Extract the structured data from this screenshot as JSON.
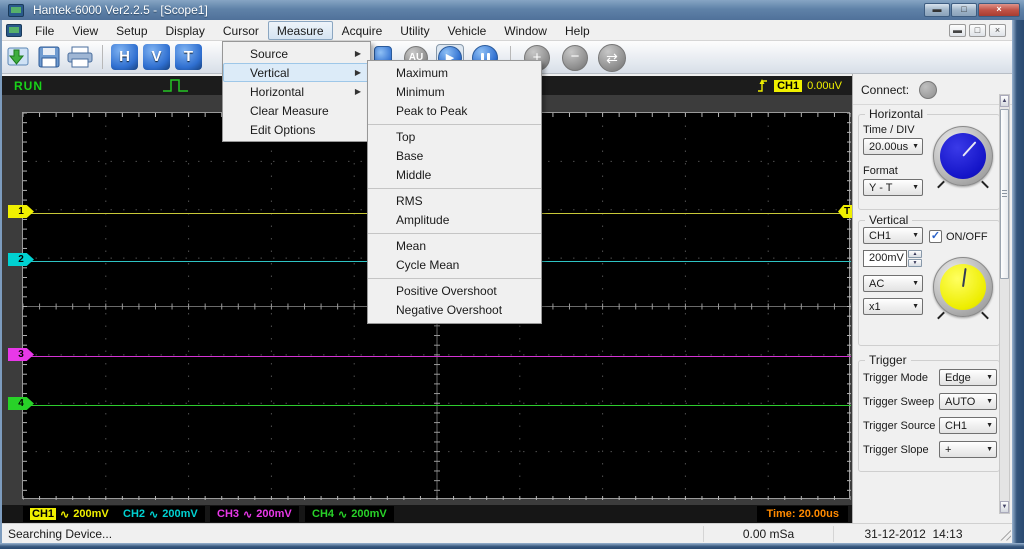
{
  "window": {
    "title": "Hantek-6000 Ver2.2.5 - [Scope1]"
  },
  "menu_bar": {
    "items": [
      "File",
      "View",
      "Setup",
      "Display",
      "Cursor",
      "Measure",
      "Acquire",
      "Utility",
      "Vehicle",
      "Window",
      "Help"
    ],
    "active_item": "Measure"
  },
  "toolbar": {
    "h_label": "H",
    "v_label": "V",
    "t_label": "T",
    "au_label": "AU"
  },
  "measure_menu": {
    "items": [
      {
        "label": "Source"
      },
      {
        "label": "Vertical"
      },
      {
        "label": "Horizontal"
      },
      {
        "label": "Clear Measure"
      },
      {
        "label": "Edit Options"
      }
    ],
    "highlighted_item": "Vertical"
  },
  "vertical_submenu": {
    "groups": [
      [
        "Maximum",
        "Minimum",
        "Peak to Peak"
      ],
      [
        "Top",
        "Base",
        "Middle"
      ],
      [
        "RMS",
        "Amplitude"
      ],
      [
        "Mean",
        "Cycle Mean"
      ],
      [
        "Positive Overshoot",
        "Negative Overshoot"
      ]
    ]
  },
  "scope": {
    "run_label": "RUN",
    "trigger_readout": {
      "channel": "CH1",
      "value": "0.00uV"
    },
    "time_readout": "Time: 20.00us",
    "trigger_marker": "T",
    "channels": [
      {
        "marker": "1",
        "name": "CH1",
        "coupling": "∿",
        "scale": "200mV",
        "color": "#f0f000"
      },
      {
        "marker": "2",
        "name": "CH2",
        "coupling": "∿",
        "scale": "200mV",
        "color": "#00d2d2"
      },
      {
        "marker": "3",
        "name": "CH3",
        "coupling": "∿",
        "scale": "200mV",
        "color": "#e838e8"
      },
      {
        "marker": "4",
        "name": "CH4",
        "coupling": "∿",
        "scale": "200mV",
        "color": "#28d228"
      }
    ],
    "grid": {
      "h_divisions": 10,
      "v_divisions": 8
    }
  },
  "right_panel": {
    "connect_label": "Connect:",
    "horizontal": {
      "title": "Horizontal",
      "time_div_label": "Time / DIV",
      "time_div_value": "20.00us",
      "format_label": "Format",
      "format_value": "Y - T",
      "knob_color": "#1414c8"
    },
    "vertical": {
      "title": "Vertical",
      "channel_value": "CH1",
      "onoff_label": "ON/OFF",
      "onoff_checked": true,
      "scale_value": "200mV",
      "coupling_value": "AC",
      "probe_value": "x1",
      "knob_color": "#eded00"
    },
    "trigger": {
      "title": "Trigger",
      "rows": [
        {
          "label": "Trigger Mode",
          "value": "Edge"
        },
        {
          "label": "Trigger Sweep",
          "value": "AUTO"
        },
        {
          "label": "Trigger Source",
          "value": "CH1"
        },
        {
          "label": "Trigger Slope",
          "value": "+"
        }
      ]
    }
  },
  "status_bar": {
    "message": "Searching Device...",
    "sample_rate": "0.00 mSa",
    "datetime": "31-12-2012  14:13"
  }
}
